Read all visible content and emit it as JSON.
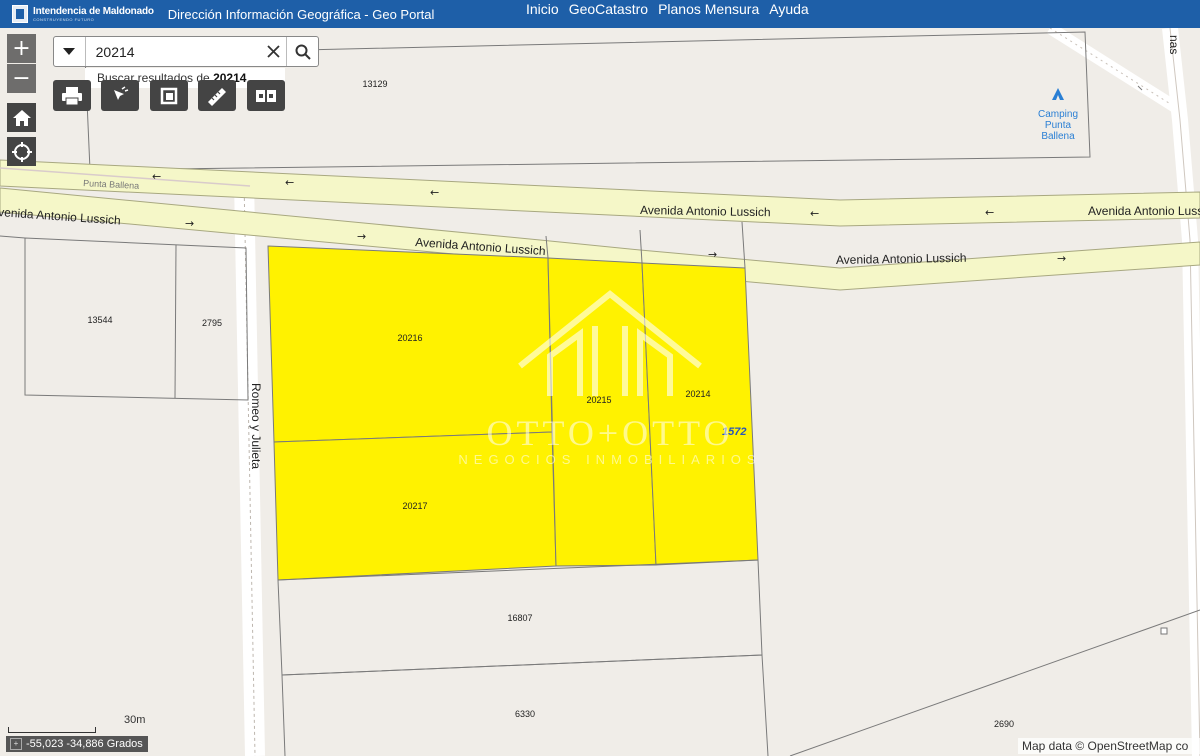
{
  "header": {
    "logo_name": "Intendencia de Maldonado",
    "logo_tagline": "CONSTRUYENDO FUTURO",
    "portal_title": "Dirección Información Geográfica -  Geo Portal",
    "nav": [
      "Inicio",
      "GeoCatastro",
      "Planos Mensura",
      "Ayuda"
    ]
  },
  "search": {
    "value": "20214",
    "suggestion_prefix": "Buscar resultados de ",
    "suggestion_term": "20214"
  },
  "zoom": {
    "in": "+",
    "out": "−"
  },
  "map": {
    "roads": {
      "main_1": "Avenida Antonio Lussich",
      "main_2": "Avenida Antonio Lussich",
      "main_3": "Avenida Antonio Lussich",
      "main_4": "Avenida Antonio Lussich",
      "main_5": "venida Antonio Lussich",
      "side": "Romeo y Julieta",
      "upper_left": "Punta Ballena",
      "top_right": "nas"
    },
    "route_number": "1572",
    "poi": [
      "Camping",
      "Punta",
      "Ballena"
    ],
    "parcels": {
      "p13129": "13129",
      "p13544": "13544",
      "p2795": "2795",
      "p20216": "20216",
      "p20215": "20215",
      "p20214": "20214",
      "p20217": "20217",
      "p16807": "16807",
      "p6330": "6330",
      "p2690": "2690"
    },
    "selected_fill": "#fff200"
  },
  "watermark": {
    "title": "OTTO+OTTO",
    "subtitle": "NEGOCIOS INMOBILIARIOS"
  },
  "scale": {
    "label": "30m"
  },
  "coords": {
    "value": "-55,023 -34,886 Grados"
  },
  "attribution": "Map data © OpenStreetMap co"
}
